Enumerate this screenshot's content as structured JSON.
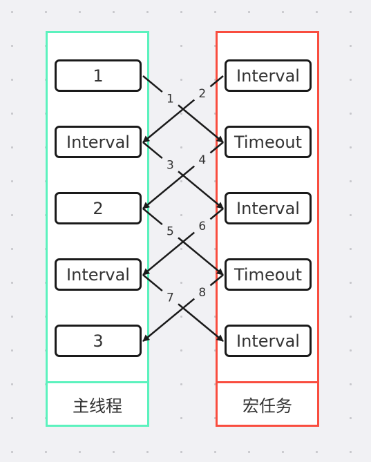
{
  "colors": {
    "main_thread": "#5cf2be",
    "macro_task": "#f94d3f",
    "arrow": "#1a1a1a"
  },
  "main_thread": {
    "title": "主线程",
    "items": [
      "1",
      "Interval",
      "2",
      "Interval",
      "3"
    ]
  },
  "macro_task": {
    "title": "宏任务",
    "items": [
      "Interval",
      "Timeout",
      "Interval",
      "Timeout",
      "Interval"
    ]
  },
  "arrows": [
    {
      "label": "1",
      "from": "main_thread.0",
      "to": "macro_task.1"
    },
    {
      "label": "2",
      "from": "macro_task.0",
      "to": "main_thread.1"
    },
    {
      "label": "3",
      "from": "main_thread.1",
      "to": "macro_task.2"
    },
    {
      "label": "4",
      "from": "macro_task.1",
      "to": "main_thread.2"
    },
    {
      "label": "5",
      "from": "main_thread.2",
      "to": "macro_task.3"
    },
    {
      "label": "6",
      "from": "macro_task.2",
      "to": "main_thread.3"
    },
    {
      "label": "7",
      "from": "main_thread.3",
      "to": "macro_task.4"
    },
    {
      "label": "8",
      "from": "macro_task.3",
      "to": "main_thread.4"
    }
  ]
}
